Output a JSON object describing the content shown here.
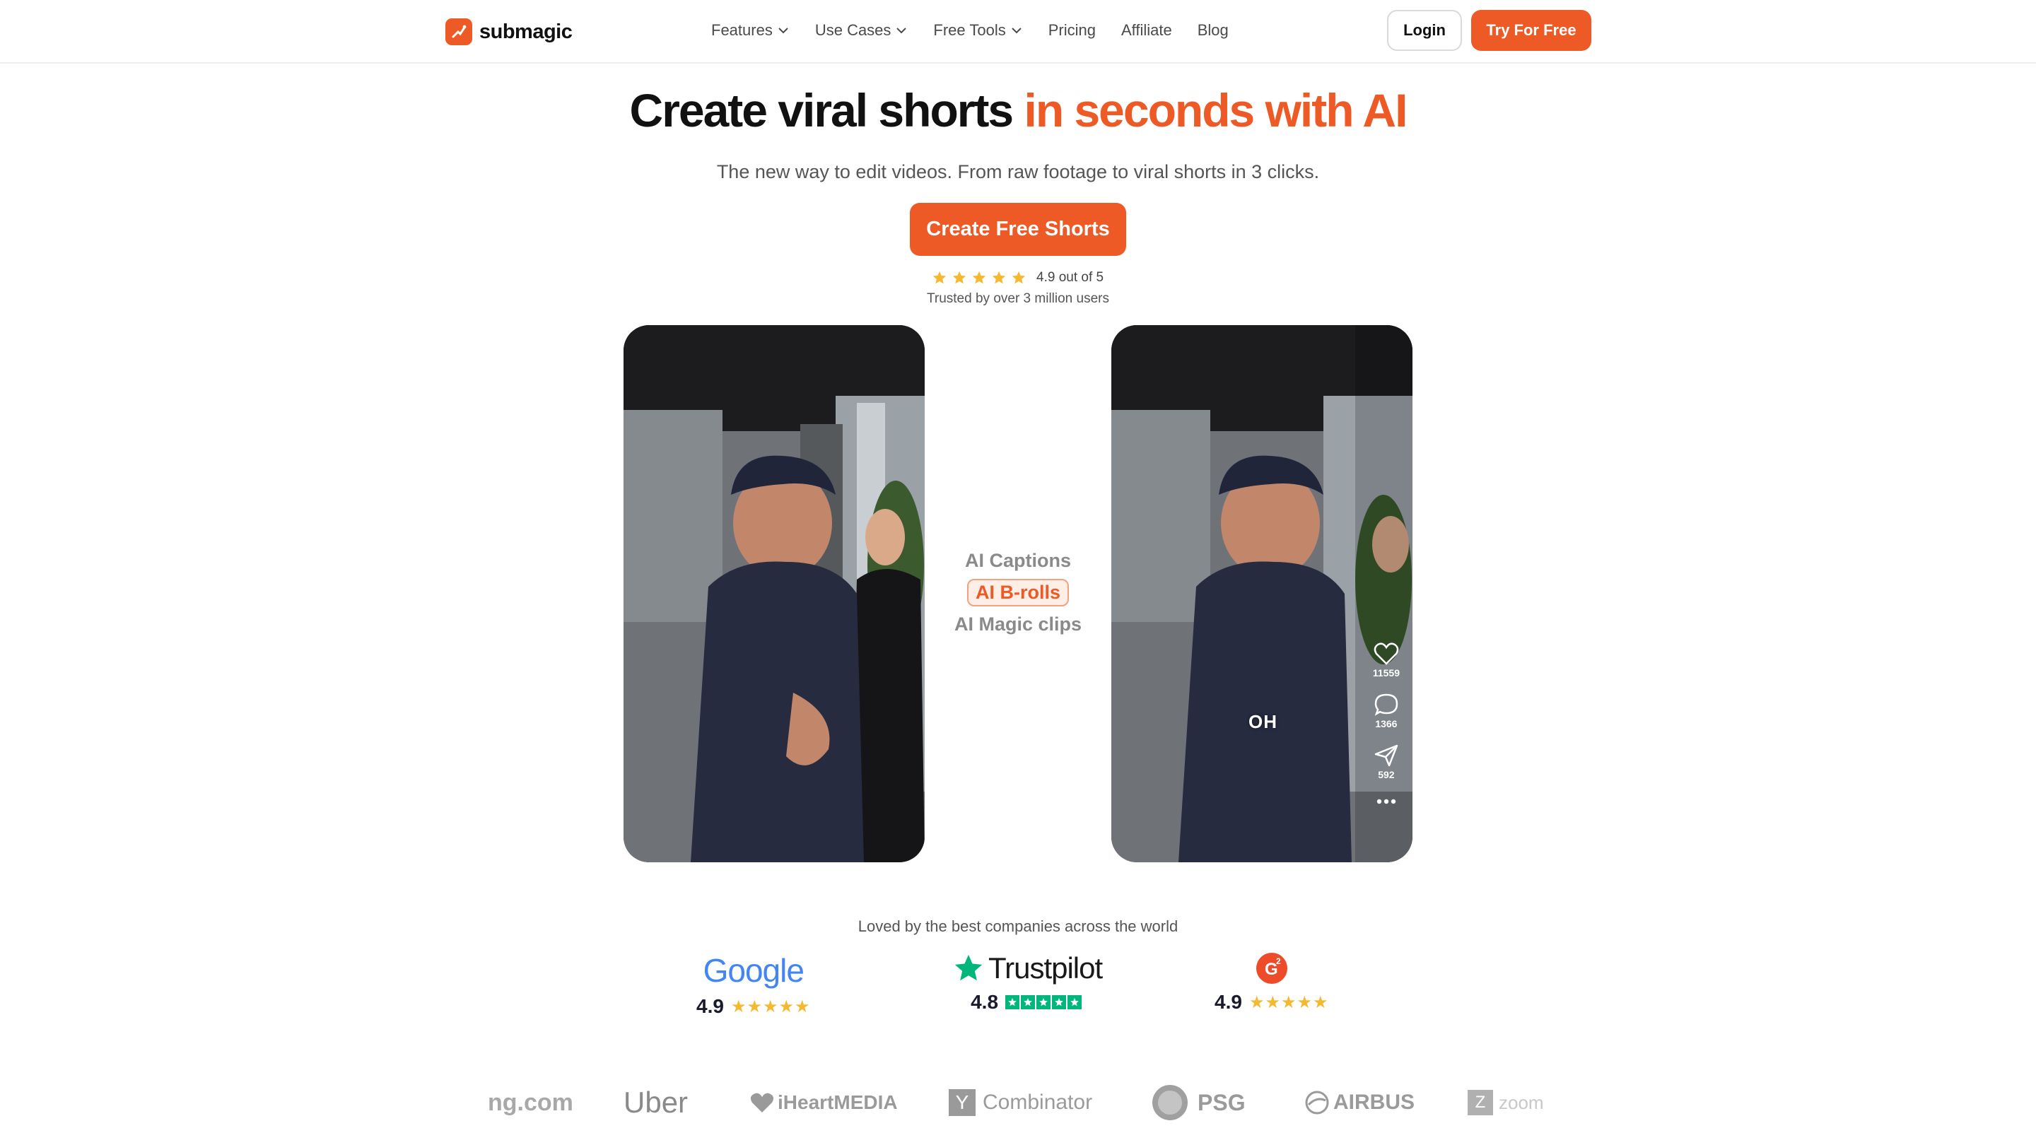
{
  "nav": {
    "brand": "submagic",
    "items": [
      {
        "label": "Features",
        "has_dropdown": true
      },
      {
        "label": "Use Cases",
        "has_dropdown": true
      },
      {
        "label": "Free Tools",
        "has_dropdown": true
      },
      {
        "label": "Pricing",
        "has_dropdown": false
      },
      {
        "label": "Affiliate",
        "has_dropdown": false
      },
      {
        "label": "Blog",
        "has_dropdown": false
      }
    ],
    "login_label": "Login",
    "try_label": "Try For Free"
  },
  "hero": {
    "headline_main": "Create viral shorts ",
    "headline_accent": "in seconds with AI",
    "subheadline": "The new way to edit videos. From raw footage to viral shorts in 3 clicks.",
    "cta_label": "Create Free Shorts",
    "rating_text": "4.9 out of 5",
    "rating_stars": 5,
    "trusted_text": "Trusted by over 3 million users"
  },
  "demo": {
    "features": [
      "AI Captions",
      "AI B-rolls",
      "AI Magic clips"
    ],
    "active_feature_index": 1,
    "caption_word": "OH",
    "likes": "11559",
    "comments": "1366",
    "shares": "592"
  },
  "social_proof": {
    "heading": "Loved by the best companies across the world",
    "reviews": [
      {
        "platform": "Google",
        "score": "4.9",
        "stars": 5
      },
      {
        "platform": "Trustpilot",
        "score": "4.8",
        "stars": 5
      },
      {
        "platform": "G2",
        "score": "4.9",
        "stars": 5
      }
    ]
  },
  "logos": [
    "ng.com",
    "Uber",
    "iHeartMEDIA",
    "Combinator",
    "PSG",
    "AIRBUS",
    "zoom"
  ],
  "colors": {
    "accent": "#ee5a26",
    "star": "#f5b82e",
    "trustpilot": "#00b67a",
    "text_muted": "#555555"
  }
}
